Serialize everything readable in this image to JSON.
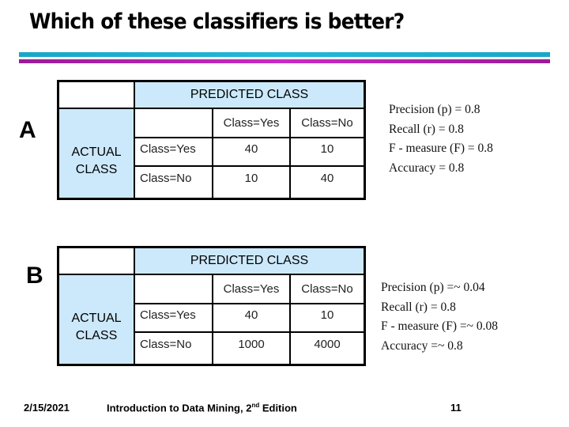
{
  "title": "Which of these classifiers is better?",
  "colors": {
    "rule_top": "#1aa6c8",
    "rule_bottom": "#b020b0",
    "header_fill": "#cce9fb"
  },
  "classifiers": [
    {
      "label": "A",
      "predicted_header": "PREDICTED CLASS",
      "actual_header_line1": "ACTUAL",
      "actual_header_line2": "CLASS",
      "columns": [
        "Class=Yes",
        "Class=No"
      ],
      "rows": [
        {
          "label": "Class=Yes",
          "values": [
            "40",
            "10"
          ]
        },
        {
          "label": "Class=No",
          "values": [
            "10",
            "40"
          ]
        }
      ],
      "metrics": [
        "Precision (p) = 0.8",
        "Recall (r) = 0.8",
        "F - measure (F) = 0.8",
        "Accuracy = 0.8"
      ]
    },
    {
      "label": "B",
      "predicted_header": "PREDICTED CLASS",
      "actual_header_line1": "ACTUAL",
      "actual_header_line2": "CLASS",
      "columns": [
        "Class=Yes",
        "Class=No"
      ],
      "rows": [
        {
          "label": "Class=Yes",
          "values": [
            "40",
            "10"
          ]
        },
        {
          "label": "Class=No",
          "values": [
            "1000",
            "4000"
          ]
        }
      ],
      "metrics": [
        "Precision (p) =~ 0.04",
        "Recall (r) = 0.8",
        "F - measure (F) =~ 0.08",
        "Accuracy =~ 0.8"
      ]
    }
  ],
  "footer": {
    "date": "2/15/2021",
    "book_prefix": "Introduction to Data Mining, 2",
    "book_sup": "nd",
    "book_suffix": " Edition",
    "page": "11"
  }
}
